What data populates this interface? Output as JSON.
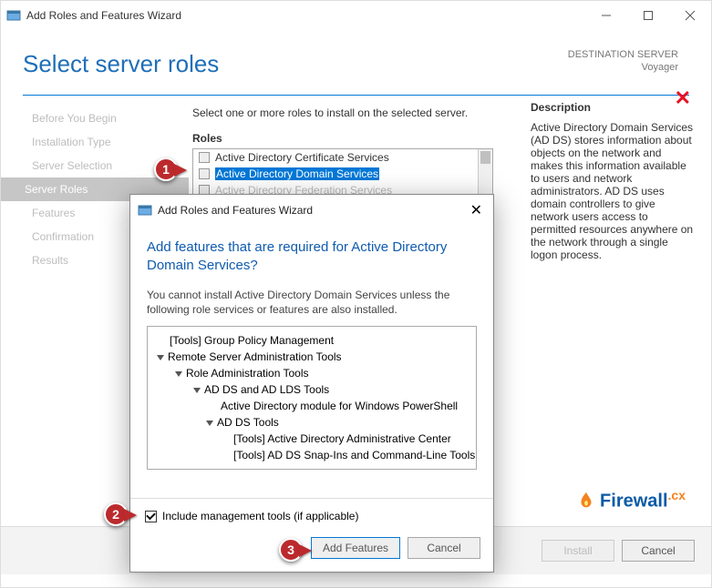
{
  "titlebar": {
    "title": "Add Roles and Features Wizard"
  },
  "hero": {
    "title": "Select server roles"
  },
  "destination": {
    "label": "DESTINATION SERVER",
    "name": "Voyager"
  },
  "nav": {
    "items": [
      {
        "label": "Before You Begin"
      },
      {
        "label": "Installation Type"
      },
      {
        "label": "Server Selection"
      },
      {
        "label": "Server Roles"
      },
      {
        "label": "Features"
      },
      {
        "label": "Confirmation"
      },
      {
        "label": "Results"
      }
    ]
  },
  "main": {
    "instruction": "Select one or more roles to install on the selected server.",
    "roles_heading": "Roles",
    "roles": [
      "Active Directory Certificate Services",
      "Active Directory Domain Services",
      "Active Directory Federation Services"
    ]
  },
  "description": {
    "heading": "Description",
    "text": "Active Directory Domain Services (AD DS) stores information about objects on the network and makes this information available to users and network administrators. AD DS uses domain controllers to give network users access to permitted resources anywhere on the network through a single logon process."
  },
  "footer": {
    "install": "Install",
    "cancel": "Cancel"
  },
  "modal": {
    "title": "Add Roles and Features Wizard",
    "question": "Add features that are required for Active Directory Domain Services?",
    "note": "You cannot install Active Directory Domain Services unless the following role services or features are also installed.",
    "tree": [
      "[Tools] Group Policy Management",
      "Remote Server Administration Tools",
      "Role Administration Tools",
      "AD DS and AD LDS Tools",
      "Active Directory module for Windows PowerShell",
      "AD DS Tools",
      "[Tools] Active Directory Administrative Center",
      "[Tools] AD DS Snap-Ins and Command-Line Tools"
    ],
    "include_label": "Include management tools (if applicable)",
    "add_features": "Add Features",
    "cancel": "Cancel"
  },
  "markers": {
    "m1": "1",
    "m2": "2",
    "m3": "3"
  },
  "watermark": {
    "brand": "Firewall",
    "suffix": ".cx"
  }
}
